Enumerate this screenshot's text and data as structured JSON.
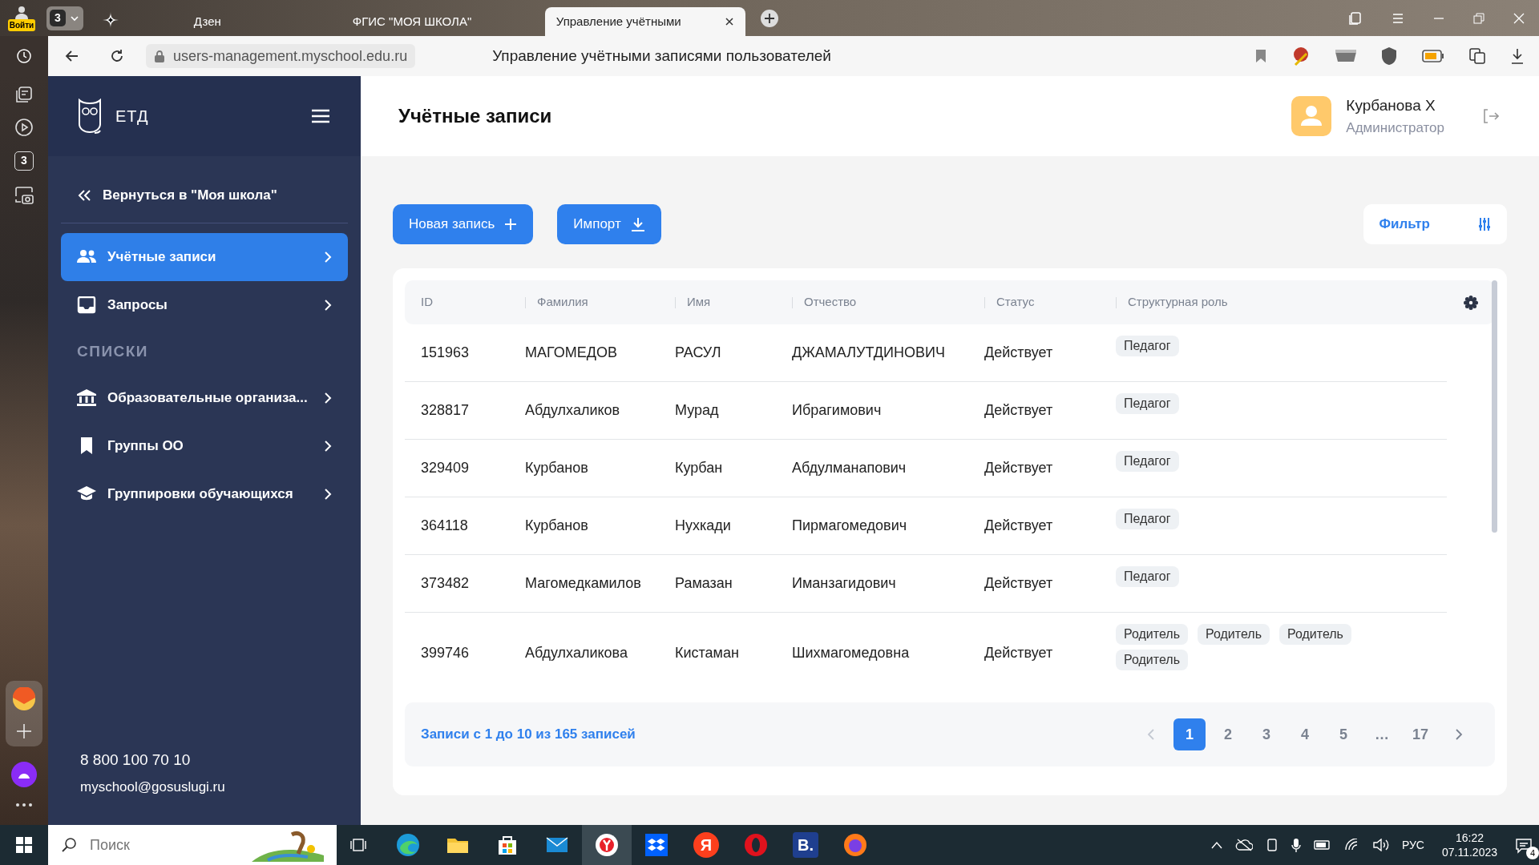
{
  "browser": {
    "profile_label": "Войти",
    "tab_count": "3",
    "tabs": [
      {
        "title": "Дзен",
        "selected": false
      },
      {
        "title": "ФГИС \"МОЯ ШКОЛА\"",
        "selected": false
      },
      {
        "title": "Управление учётными",
        "selected": true
      }
    ],
    "address": "users-management.myschool.edu.ru",
    "page_title": "Управление учётными записями пользователей"
  },
  "side_panel": {
    "badge": "3"
  },
  "sidebar": {
    "logo": "ЕТД",
    "back_link": "Вернуться в \"Моя школа\"",
    "items": [
      {
        "kind": "item",
        "label": "Учётные записи",
        "selected": true
      },
      {
        "kind": "item",
        "label": "Запросы",
        "selected": false
      },
      {
        "kind": "section",
        "label": "СПИСКИ"
      },
      {
        "kind": "item",
        "label": "Образовательные организа...",
        "selected": false
      },
      {
        "kind": "item",
        "label": "Группы ОО",
        "selected": false
      },
      {
        "kind": "item",
        "label": "Группировки обучающихся",
        "selected": false
      }
    ],
    "phone": "8 800 100 70 10",
    "email": "myschool@gosuslugi.ru"
  },
  "header": {
    "title": "Учётные записи",
    "user_name": "Курбанова Х",
    "user_role": "Администратор"
  },
  "toolbar": {
    "new_button": "Новая запись",
    "import_button": "Импорт",
    "filter_button": "Фильтр"
  },
  "table": {
    "columns": [
      "ID",
      "Фамилия",
      "Имя",
      "Отчество",
      "Статус",
      "Структурная роль"
    ],
    "rows": [
      {
        "cells": [
          "151963",
          "МАГОМЕДОВ",
          "РАСУЛ",
          "ДЖАМАЛУТДИНОВИЧ",
          "Действует"
        ],
        "roles": [
          "Педагог"
        ]
      },
      {
        "cells": [
          "328817",
          "Абдулхаликов",
          "Мурад",
          "Ибрагимович",
          "Действует"
        ],
        "roles": [
          "Педагог"
        ]
      },
      {
        "cells": [
          "329409",
          "Курбанов",
          "Курбан",
          "Абдулманапович",
          "Действует"
        ],
        "roles": [
          "Педагог"
        ]
      },
      {
        "cells": [
          "364118",
          "Курбанов",
          "Нухкади",
          "Пирмагомедович",
          "Действует"
        ],
        "roles": [
          "Педагог"
        ]
      },
      {
        "cells": [
          "373482",
          "Магомедкамилов",
          "Рамазан",
          "Иманзагидович",
          "Действует"
        ],
        "roles": [
          "Педагог"
        ]
      },
      {
        "cells": [
          "399746",
          "Абдулхаликова",
          "Кистаман",
          "Шихмагомедовна",
          "Действует"
        ],
        "roles": [
          "Родитель",
          "Родитель",
          "Родитель",
          "Родитель"
        ]
      }
    ]
  },
  "pagination": {
    "summary": "Записи с 1 до 10 из 165 записей",
    "pages": [
      {
        "label": "1",
        "selected": true
      },
      {
        "label": "2",
        "selected": false
      },
      {
        "label": "3",
        "selected": false
      },
      {
        "label": "4",
        "selected": false
      },
      {
        "label": "5",
        "selected": false
      },
      {
        "label": "…",
        "selected": false
      },
      {
        "label": "17",
        "selected": false
      }
    ]
  },
  "taskbar": {
    "search_placeholder": "Поиск",
    "apps": [
      {
        "kind": "edge",
        "selected": false
      },
      {
        "kind": "folder",
        "selected": false
      },
      {
        "kind": "store",
        "selected": false
      },
      {
        "kind": "mail",
        "selected": false
      },
      {
        "kind": "yandex",
        "selected": true
      },
      {
        "kind": "dropbox",
        "selected": false
      },
      {
        "kind": "letter",
        "label": "Я",
        "color": "#fc3f1d",
        "selected": false
      },
      {
        "kind": "opera",
        "selected": false
      },
      {
        "kind": "letter",
        "label": "B.",
        "color": "#1f3f8f",
        "selected": false
      },
      {
        "kind": "firefox",
        "selected": false
      }
    ],
    "language": "РУС",
    "time": "16:22",
    "date": "07.11.2023",
    "notifications": "4"
  }
}
